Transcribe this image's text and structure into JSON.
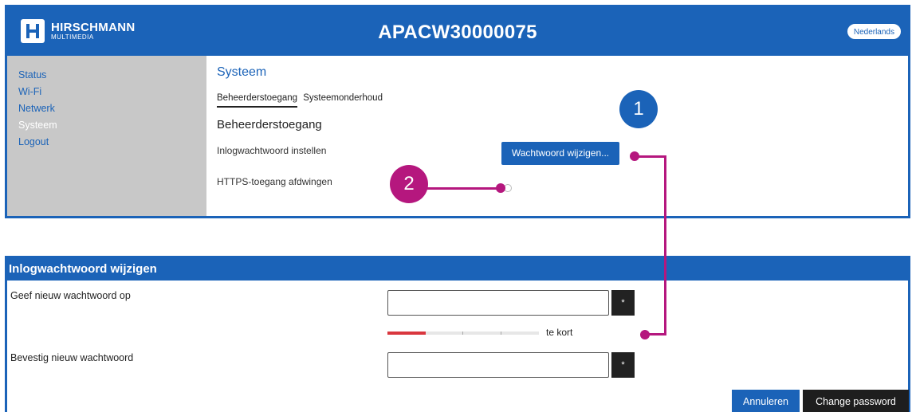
{
  "header": {
    "logo_name": "HIRSCHMANN",
    "logo_sub": "MULTIMEDIA",
    "device_title": "APACW30000075",
    "language_button": "Nederlands"
  },
  "sidebar": {
    "items": [
      {
        "label": "Status"
      },
      {
        "label": "Wi-Fi"
      },
      {
        "label": "Netwerk"
      },
      {
        "label": "Systeem"
      },
      {
        "label": "Logout"
      }
    ],
    "active": "Systeem"
  },
  "main": {
    "section_title": "Systeem",
    "tabs": [
      {
        "label": "Beheerderstoegang"
      },
      {
        "label": "Systeemonderhoud"
      }
    ],
    "sub_heading": "Beheerderstoegang",
    "password_setting_label": "Inlogwachtwoord instellen",
    "change_password_button": "Wachtwoord wijzigen...",
    "https_label": "HTTPS-toegang afdwingen"
  },
  "dialog": {
    "title": "Inlogwachtwoord wijzigen",
    "new_password_label": "Geef nieuw wachtwoord op",
    "new_password_value": "",
    "reveal_label": "*",
    "strength_text": "te kort",
    "strength_level": 0.25,
    "confirm_password_label": "Bevestig nieuw wachtwoord",
    "confirm_password_value": "",
    "cancel_button": "Annuleren",
    "submit_button": "Change password"
  },
  "annotations": {
    "marker_1": "1",
    "marker_2": "2"
  },
  "colors": {
    "brand_blue": "#1b63b8",
    "sidebar_gray": "#c8c8c8",
    "annotation_magenta": "#b5177e",
    "strength_red": "#d9363e",
    "dark_button": "#1e1e1e"
  }
}
